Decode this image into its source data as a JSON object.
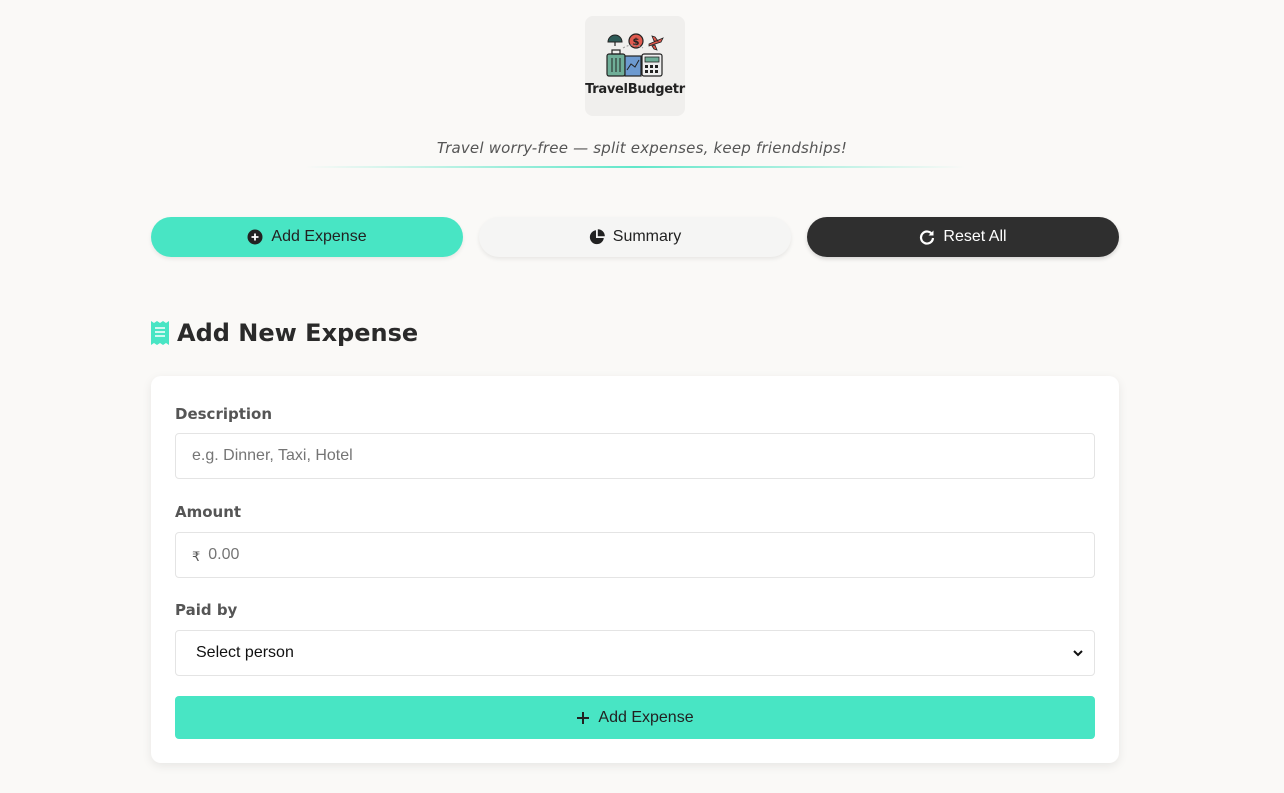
{
  "brand": {
    "logo_text": "TravelBudgetr",
    "tagline": "Travel worry-free — split expenses, keep friendships!"
  },
  "nav": {
    "add_label": "Add Expense",
    "summary_label": "Summary",
    "reset_label": "Reset All"
  },
  "section": {
    "title": "Add New Expense",
    "icon": "receipt-icon"
  },
  "form": {
    "description_label": "Description",
    "description_placeholder": "e.g. Dinner, Taxi, Hotel",
    "amount_label": "Amount",
    "currency_symbol": "₹",
    "amount_placeholder": "0.00",
    "paid_by_label": "Paid by",
    "paid_by_selected": "Select person",
    "submit_label": "Add Expense"
  },
  "colors": {
    "accent": "#48e5c4",
    "dark": "#2f2f2f",
    "background": "#faf9f7"
  }
}
